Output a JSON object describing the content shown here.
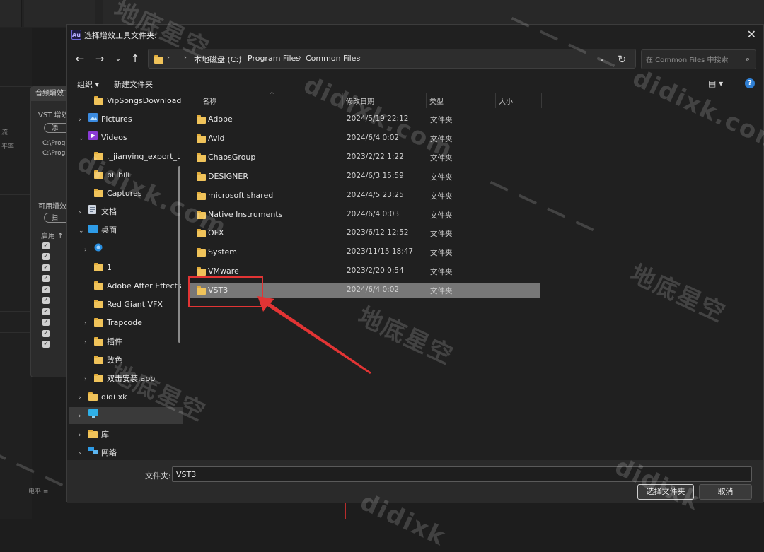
{
  "background": {
    "panel_tab": "音频增效工",
    "vst_label": "VST 增效工",
    "add_btn": "添",
    "path1": "C:\\Progr",
    "path2": "C:\\Progr",
    "available_label": "可用增效",
    "scan_btn": "扫",
    "enabled_header": "启用",
    "left_stub1": "流",
    "left_stub2": "平率",
    "bottom_label": "电平"
  },
  "dialog": {
    "title": "选择增效工具文件夹:",
    "app_icon": "Au",
    "address": {
      "crumbs": [
        "本地磁盘 (C:)",
        "Program Files",
        "Common Files"
      ]
    },
    "search_placeholder": "在 Common Files 中搜索",
    "toolbar": {
      "organize": "组织 ▾",
      "new_folder": "新建文件夹"
    },
    "nav_tree": [
      {
        "label": "VipSongsDownload",
        "icon": "folder-icon",
        "indent": 2,
        "chevron": false
      },
      {
        "label": "Pictures",
        "icon": "pictures-icon",
        "indent": 1,
        "chevron": true
      },
      {
        "label": "Videos",
        "icon": "videos-icon",
        "indent": 1,
        "chevron": "open"
      },
      {
        "label": "._jianying_export_t",
        "icon": "folder-icon",
        "indent": 2,
        "chevron": false
      },
      {
        "label": "bilibili",
        "icon": "folder-icon",
        "indent": 2,
        "chevron": false
      },
      {
        "label": "Captures",
        "icon": "folder-icon",
        "indent": 2,
        "chevron": false
      },
      {
        "label": "文档",
        "icon": "documents-icon",
        "indent": 1,
        "chevron": true
      },
      {
        "label": "桌面",
        "icon": "desktop-icon",
        "indent": 1,
        "chevron": "open"
      },
      {
        "label": "",
        "icon": "globe-app-icon",
        "indent": 2,
        "chevron": true
      },
      {
        "label": "1",
        "icon": "folder-icon",
        "indent": 2,
        "chevron": false
      },
      {
        "label": "Adobe After Effects",
        "icon": "folder-icon",
        "indent": 2,
        "chevron": false
      },
      {
        "label": "Red Giant VFX",
        "icon": "folder-icon",
        "indent": 2,
        "chevron": false
      },
      {
        "label": "Trapcode",
        "icon": "folder-icon",
        "indent": 2,
        "chevron": true
      },
      {
        "label": "插件",
        "icon": "folder-icon",
        "indent": 2,
        "chevron": true
      },
      {
        "label": "改色",
        "icon": "folder-icon",
        "indent": 2,
        "chevron": false
      },
      {
        "label": "双击安装.app",
        "icon": "folder-icon",
        "indent": 2,
        "chevron": true
      },
      {
        "label": "didi xk",
        "icon": "folder-icon",
        "indent": 1,
        "chevron": true
      },
      {
        "label": "",
        "icon": "this-pc-icon",
        "indent": 1,
        "chevron": true,
        "selected": true
      },
      {
        "label": "库",
        "icon": "library-icon",
        "indent": 1,
        "chevron": true
      },
      {
        "label": "网络",
        "icon": "network-icon",
        "indent": 1,
        "chevron": true
      }
    ],
    "columns": {
      "name": "名称",
      "modified": "修改日期",
      "type": "类型",
      "size": "大小"
    },
    "files": [
      {
        "name": "Adobe",
        "date": "2024/5/19 22:12",
        "type": "文件夹"
      },
      {
        "name": "Avid",
        "date": "2024/6/4 0:02",
        "type": "文件夹"
      },
      {
        "name": "ChaosGroup",
        "date": "2023/2/22 1:22",
        "type": "文件夹"
      },
      {
        "name": "DESIGNER",
        "date": "2024/6/3 15:59",
        "type": "文件夹"
      },
      {
        "name": "microsoft shared",
        "date": "2024/4/5 23:25",
        "type": "文件夹"
      },
      {
        "name": "Native Instruments",
        "date": "2024/6/4 0:03",
        "type": "文件夹"
      },
      {
        "name": "OFX",
        "date": "2023/6/12 12:52",
        "type": "文件夹"
      },
      {
        "name": "System",
        "date": "2023/11/15 18:47",
        "type": "文件夹"
      },
      {
        "name": "VMware",
        "date": "2023/2/20 0:54",
        "type": "文件夹"
      },
      {
        "name": "VST3",
        "date": "2024/6/4 0:02",
        "type": "文件夹",
        "selected": true
      }
    ],
    "folder_label": "文件夹:",
    "folder_value": "VST3",
    "select_button": "选择文件夹",
    "cancel_button": "取消"
  },
  "watermark": {
    "cn": "地底星空",
    "en": "didixk.com",
    "en2": "didixk"
  },
  "colors": {
    "folder": "#f0c35a",
    "selection": "#777777",
    "annotation": "#e23434",
    "accent_help": "#2f7fd3"
  }
}
